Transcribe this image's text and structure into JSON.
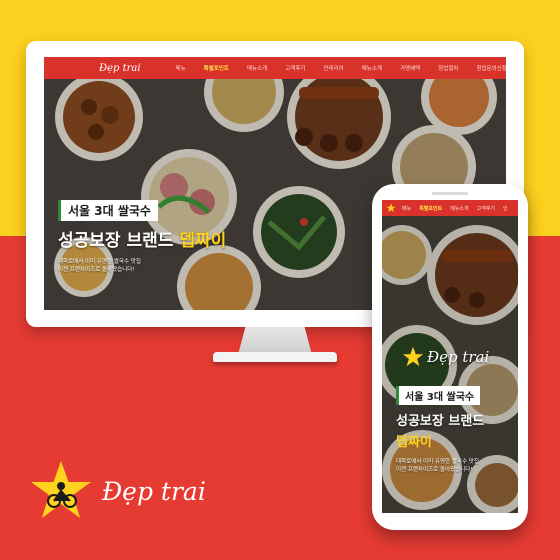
{
  "brand": {
    "name": "Đẹp trai",
    "star_color": "#ffd21e",
    "red": "#d9322b",
    "yellow": "#fcd01e"
  },
  "monitor": {
    "nav": {
      "items": [
        {
          "label": "메뉴"
        },
        {
          "label": "특별포인트",
          "active": true
        },
        {
          "label": "메뉴소개"
        },
        {
          "label": "고객후기"
        },
        {
          "label": "인테리어"
        },
        {
          "label": "매뉴소개"
        },
        {
          "label": "가맹혜택"
        },
        {
          "label": "창업절차"
        },
        {
          "label": "창업문의신청"
        }
      ]
    },
    "hero": {
      "tag": "서울 3대 쌀국수",
      "main_prefix": "성공보장 브랜드 ",
      "main_highlight": "뎁짜이",
      "sub_line1": "대학로에서 이미 유명한 쌀국수 맛집",
      "sub_line2": "이젠 프랜차이즈로 돌아왔습니다!"
    }
  },
  "phone": {
    "nav": {
      "items": [
        {
          "label": "메뉴"
        },
        {
          "label": "특별포인트",
          "active": true
        },
        {
          "label": "메뉴소개"
        },
        {
          "label": "고객후기"
        },
        {
          "label": "인"
        }
      ]
    },
    "logo_text": "Đẹp trai",
    "hero": {
      "tag": "서울 3대 쌀국수",
      "main": "성공보장 브랜드",
      "highlight": "뎁짜이",
      "sub_line1": "대학로에서 이미 유명한 쌀국수 맛집",
      "sub_line2": "이젠 프랜차이즈로 돌아왔습니다!"
    }
  },
  "footer_logo": {
    "text": "Đẹp trai"
  }
}
